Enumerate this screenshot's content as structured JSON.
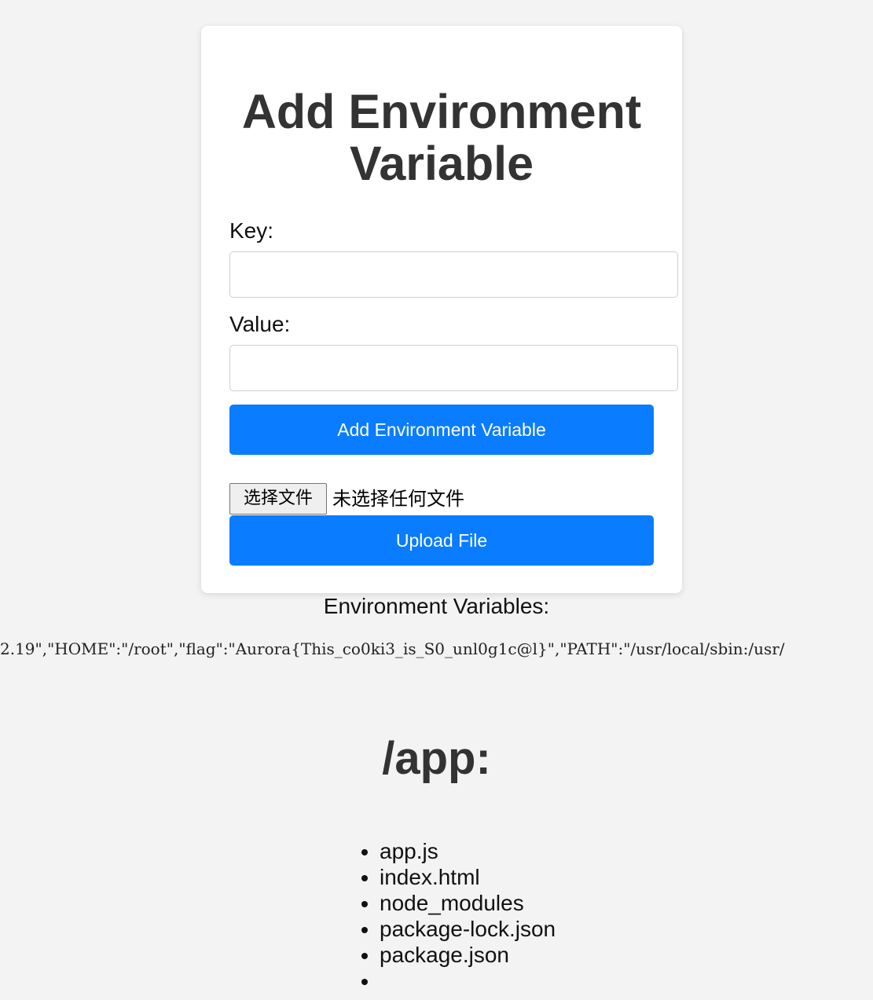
{
  "form": {
    "title": "Add Environment Variable",
    "key_label": "Key:",
    "key_value": "",
    "value_label": "Value:",
    "value_value": "",
    "submit_label": "Add Environment Variable",
    "file_button_label": "选择文件",
    "file_status": "未选择任何文件",
    "upload_label": "Upload File"
  },
  "env": {
    "heading": "Environment Variables:",
    "dump": "2.19\",\"HOME\":\"/root\",\"flag\":\"Aurora{This_co0ki3_is_S0_unl0g1c@l}\",\"PATH\":\"/usr/local/sbin:/usr/"
  },
  "directory": {
    "title": "/app:",
    "files": [
      "app.js",
      "index.html",
      "node_modules",
      "package-lock.json",
      "package.json",
      ""
    ]
  },
  "colors": {
    "accent": "#0a7cff",
    "background": "#f3f3f3",
    "card": "#ffffff"
  }
}
